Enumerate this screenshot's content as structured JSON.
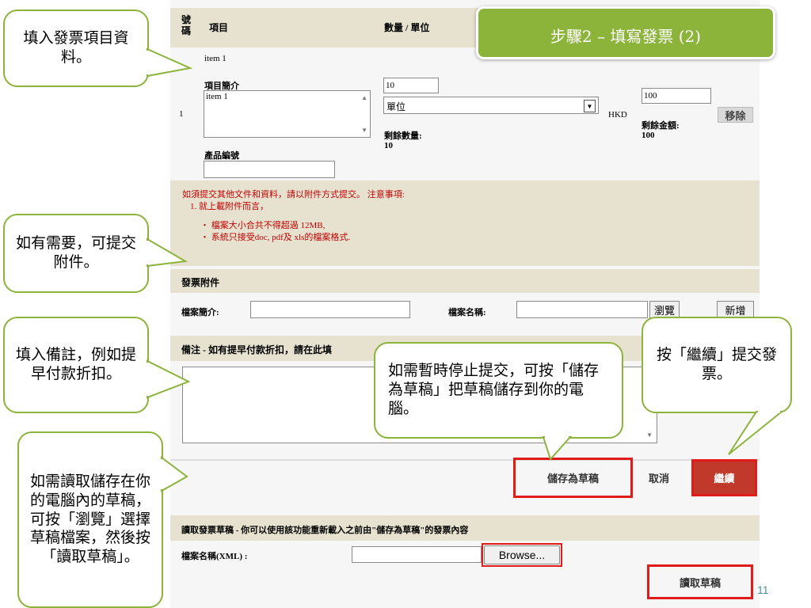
{
  "step_title": "步驟2 – 填寫發票 (2)",
  "page_number": "11",
  "colors": {
    "accent_green": "#8cb33a",
    "callout_border": "#8cb33a",
    "highlight_red": "#e11a1a",
    "continue_bg": "#c0392b",
    "band": "#e6e2cf"
  },
  "table": {
    "col_no": "號碼",
    "col_item": "項目",
    "col_qty": "數量 / 單位",
    "row_no": "1",
    "item_name": "item 1",
    "desc_label": "項目簡介",
    "desc_value": "item 1",
    "product_code_label": "產品編號",
    "qty_value": "10",
    "unit_value": "單位",
    "remaining_qty_label": "剩餘數量:",
    "remaining_qty_value": "10",
    "currency": "HKD",
    "amount_value": "100",
    "remaining_amount_label": "剩餘金額:",
    "remaining_amount_value": "100",
    "remove_label": "移除"
  },
  "notice": {
    "line1": "如須提交其他文件和資料，請以附件方式提交。 注意事項:",
    "line2": "1. 就上載附件而言，",
    "bullet1": "・ 檔案大小合共不得超過 12MB,",
    "bullet2": "・ 系統只接受doc, pdf及 xls的檔案格式."
  },
  "attachments": {
    "heading": "發票附件",
    "desc_label": "檔案簡介:",
    "name_label": "檔案名稱:",
    "browse_label": "瀏覽",
    "add_label": "新增"
  },
  "remarks": {
    "heading": "備注 - 如有提早付款折扣，請在此填"
  },
  "actions": {
    "save_draft": "儲存為草稿",
    "cancel": "取消",
    "continue": "繼續"
  },
  "load_draft": {
    "heading": "讀取發票草稿 - 你可以使用該功能重新載入之前由\"儲存為草稿\"的發票內容",
    "file_label": "檔案名稱(XML) :",
    "browse_button": "Browse...",
    "load_button": "讀取草稿"
  },
  "callouts": {
    "fill_item": "填入發票項目資料。",
    "attach": "如有需要，可提交附件。",
    "remarks": "填入備註，例如提早付款折扣。",
    "load_draft": "如需讀取儲存在你的電腦內的草稿，可按「瀏覽」選擇草稿檔案，然後按「讀取草稿」。",
    "save_draft": "如需暫時停止提交，可按「儲存為草稿」把草稿儲存到你的電腦。",
    "submit": "按「繼續」提交發票。"
  }
}
